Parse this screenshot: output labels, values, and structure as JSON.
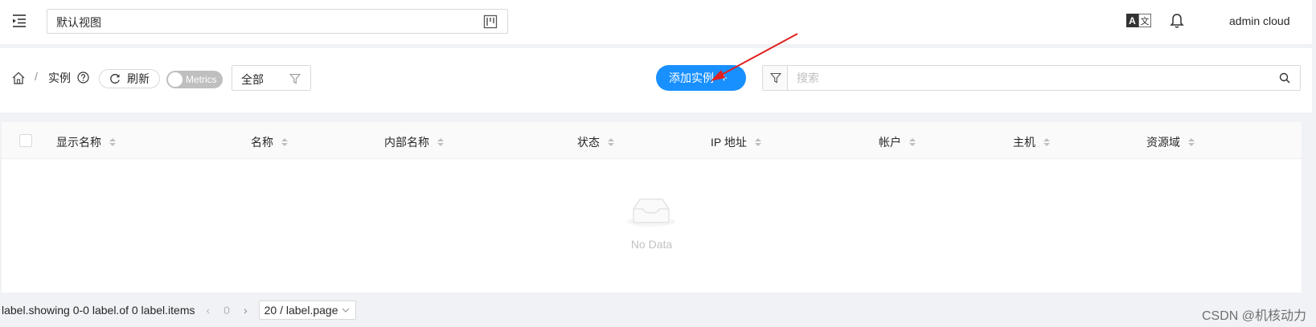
{
  "header": {
    "view_name": "默认视图",
    "user": "admin cloud"
  },
  "breadcrumb": {
    "current": "实例"
  },
  "toolbar": {
    "refresh_label": "刷新",
    "metrics_label": "Metrics",
    "scope_value": "全部",
    "add_label": "添加实例",
    "search_placeholder": "搜索"
  },
  "table": {
    "columns": [
      "显示名称",
      "名称",
      "内部名称",
      "状态",
      "IP 地址",
      "帐户",
      "主机",
      "资源域"
    ],
    "empty_text": "No Data"
  },
  "pagination": {
    "total_text": "label.showing 0-0 label.of 0 label.items",
    "current_page": "0",
    "page_size": "20 / label.page"
  },
  "watermark": "CSDN @机核动力",
  "colors": {
    "primary": "#1890ff",
    "annotation": "#e02020"
  },
  "icons": [
    "menu-fold-icon",
    "board-icon",
    "translate-icon",
    "bell-icon",
    "home-icon",
    "question-circle-icon",
    "reload-icon",
    "filter-icon",
    "search-icon",
    "inbox-icon"
  ]
}
